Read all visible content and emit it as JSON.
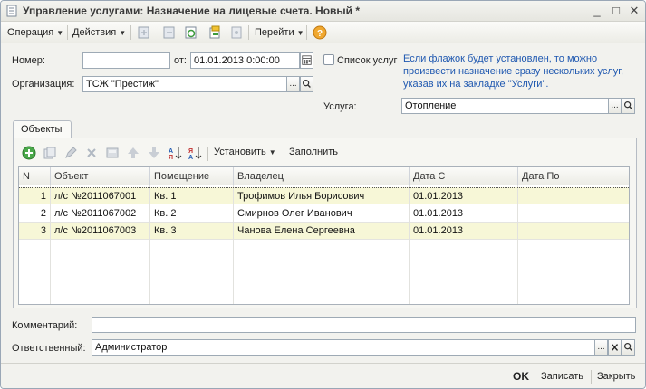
{
  "window": {
    "title": "Управление услугами: Назначение на лицевые счета. Новый *",
    "minimize": "_",
    "maximize": "□",
    "close": "✕"
  },
  "toolbar": {
    "operation": "Операция",
    "actions": "Действия",
    "goto": "Перейти",
    "help": "?"
  },
  "header": {
    "number_label": "Номер:",
    "number_value": "",
    "from_label": "от:",
    "date_value": "01.01.2013  0:00:00",
    "service_list_label": "Список услуг",
    "hint": "Если флажок будет установлен, то можно произвести назначение сразу нескольких услуг, указав их на закладке \"Услуги\".",
    "org_label": "Организация:",
    "org_value": "ТСЖ \"Престиж\"",
    "service_label": "Услуга:",
    "service_value": "Отопление"
  },
  "tabs": {
    "objects": "Объекты"
  },
  "grid_toolbar": {
    "set_label": "Установить",
    "fill_label": "Заполнить"
  },
  "grid": {
    "columns": [
      "N",
      "Объект",
      "Помещение",
      "Владелец",
      "Дата С",
      "Дата По"
    ],
    "rows": [
      {
        "n": "1",
        "object": "л/с №2011067001",
        "room": "Кв. 1",
        "owner": "Трофимов Илья Борисович",
        "date_from": "01.01.2013",
        "date_to": ""
      },
      {
        "n": "2",
        "object": "л/с №2011067002",
        "room": "Кв. 2",
        "owner": "Смирнов Олег Иванович",
        "date_from": "01.01.2013",
        "date_to": ""
      },
      {
        "n": "3",
        "object": "л/с №2011067003",
        "room": "Кв. 3",
        "owner": "Чанова Елена Сергеевна",
        "date_from": "01.01.2013",
        "date_to": ""
      }
    ]
  },
  "footer": {
    "comment_label": "Комментарий:",
    "comment_value": "",
    "responsible_label": "Ответственный:",
    "responsible_value": "Администратор",
    "ok": "OK",
    "save": "Записать",
    "close": "Закрыть"
  },
  "colors": {
    "hint_text": "#1f58b0",
    "selected_row": "#f7f7d7",
    "window_bg": "#f2f2ee"
  }
}
